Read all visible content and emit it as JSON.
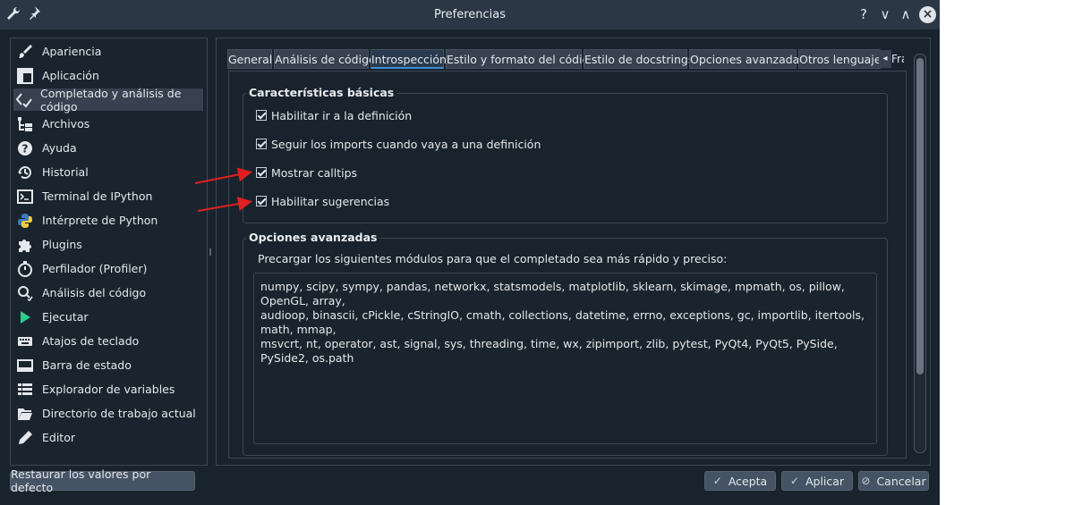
{
  "window": {
    "title": "Preferencias"
  },
  "titlebar": {
    "help_glyph": "?",
    "minimize_glyph": "∨",
    "maximize_glyph": "∧",
    "close_glyph": "×"
  },
  "sidebar": {
    "items": [
      {
        "label": "Apariencia",
        "icon": "paintbrush-icon"
      },
      {
        "label": "Aplicación",
        "icon": "window-layout-icon"
      },
      {
        "label": "Completado y análisis de código",
        "icon": "code-completion-icon",
        "selected": true
      },
      {
        "label": "Archivos",
        "icon": "file-tree-icon"
      },
      {
        "label": "Ayuda",
        "icon": "help-circle-icon"
      },
      {
        "label": "Historial",
        "icon": "history-icon"
      },
      {
        "label": "Terminal de IPython",
        "icon": "terminal-icon"
      },
      {
        "label": "Intérprete de Python",
        "icon": "python-logo-icon"
      },
      {
        "label": "Plugins",
        "icon": "puzzle-icon"
      },
      {
        "label": "Perfilador (Profiler)",
        "icon": "stopwatch-icon"
      },
      {
        "label": "Análisis del código",
        "icon": "magnifier-check-icon"
      },
      {
        "label": "Ejecutar",
        "icon": "play-icon"
      },
      {
        "label": "Atajos de teclado",
        "icon": "keyboard-icon"
      },
      {
        "label": "Barra de estado",
        "icon": "status-bar-icon"
      },
      {
        "label": "Explorador de variables",
        "icon": "table-list-icon"
      },
      {
        "label": "Directorio de trabajo actual",
        "icon": "folder-open-icon"
      },
      {
        "label": "Editor",
        "icon": "pencil-icon"
      }
    ]
  },
  "tabs": [
    {
      "label": "General"
    },
    {
      "label": "Análisis de código"
    },
    {
      "label": "Introspección",
      "active": true
    },
    {
      "label": "Estilo y formato del código"
    },
    {
      "label": "Estilo de docstrings"
    },
    {
      "label": "Opciones avanzadas"
    },
    {
      "label": "Otros lenguajes"
    }
  ],
  "tabs_overflow": {
    "scroll_glyph": "◂",
    "partial_label": "Frag"
  },
  "basic": {
    "title": "Características básicas",
    "options": [
      {
        "label": "Habilitar ir a la definición",
        "checked": true
      },
      {
        "label": "Seguir los imports cuando vaya a una definición",
        "checked": true
      },
      {
        "label": "Mostrar calltips",
        "checked": true
      },
      {
        "label": "Habilitar sugerencias",
        "checked": true
      }
    ]
  },
  "advanced": {
    "title": "Opciones avanzadas",
    "description": "Precargar los siguientes módulos para que el completado sea más rápido y preciso:",
    "modules_lines": [
      "numpy, scipy, sympy, pandas, networkx, statsmodels, matplotlib, sklearn, skimage, mpmath, os, pillow, OpenGL, array,",
      "audioop, binascii, cPickle, cStringIO, cmath, collections, datetime, errno, exceptions, gc, importlib, itertools, math, mmap,",
      "msvcrt, nt, operator, ast, signal, sys, threading, time, wx, zipimport, zlib, pytest, PyQt4, PyQt5, PySide, PySide2, os.path"
    ]
  },
  "buttons": {
    "reset": "Restaurar los valores por defecto",
    "accept": "Acepta",
    "apply": "Aplicar",
    "cancel": "Cancelar"
  },
  "colors": {
    "window_bg": "#19232d",
    "titlebar_bg": "#2b3744",
    "accent": "#3d8fd6",
    "annotation_arrow": "#e02020"
  }
}
